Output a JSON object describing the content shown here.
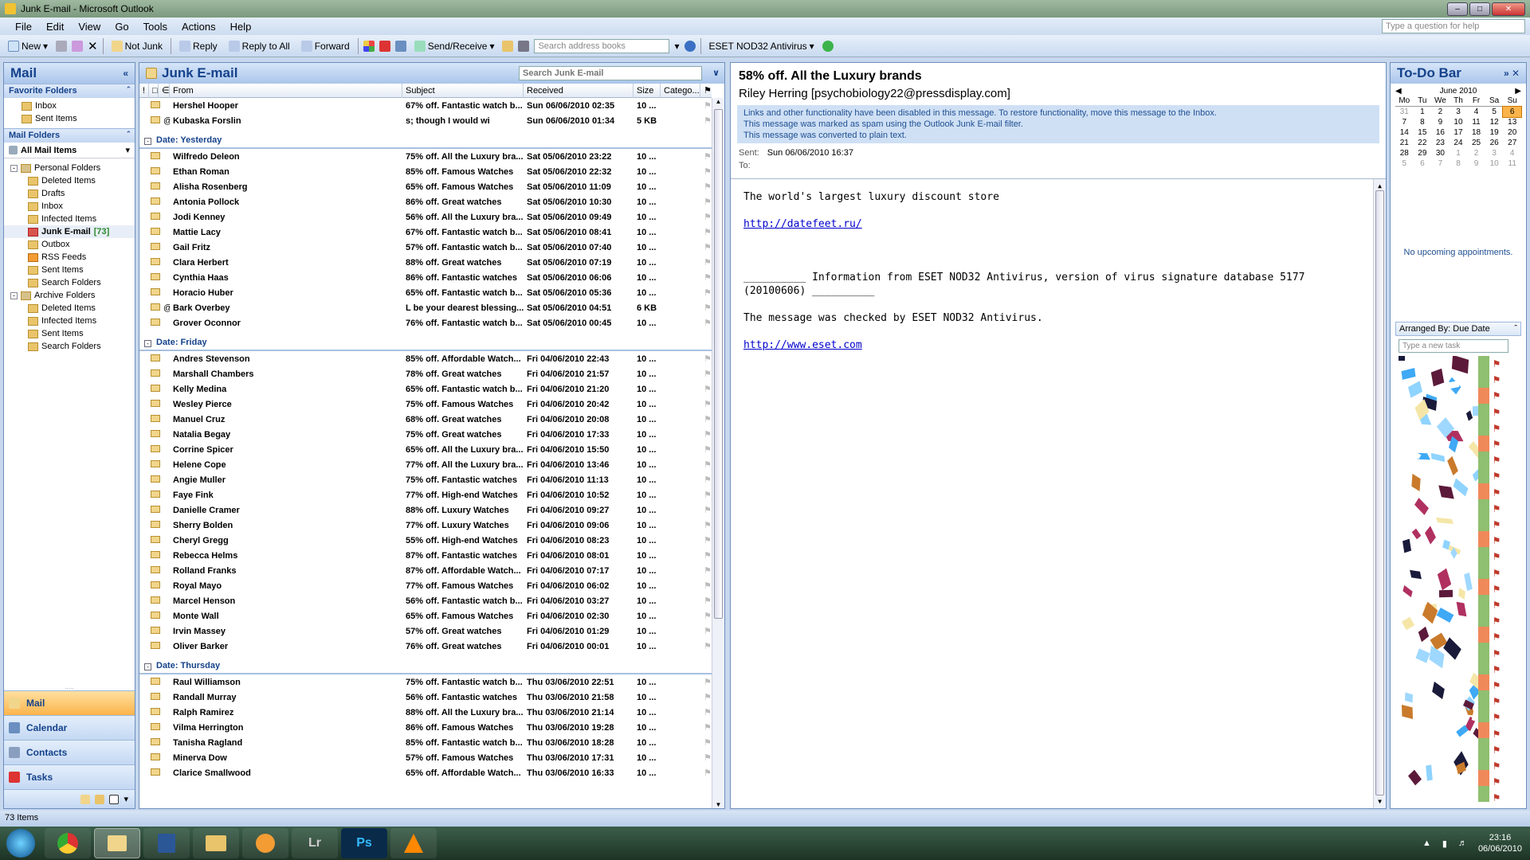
{
  "window": {
    "title": "Junk E-mail - Microsoft Outlook"
  },
  "menu": [
    "File",
    "Edit",
    "View",
    "Go",
    "Tools",
    "Actions",
    "Help"
  ],
  "help_placeholder": "Type a question for help",
  "toolbar": {
    "new": "New",
    "not_junk": "Not Junk",
    "reply": "Reply",
    "reply_all": "Reply to All",
    "forward": "Forward",
    "send_receive": "Send/Receive",
    "address_placeholder": "Search address books",
    "eset": "ESET NOD32 Antivirus"
  },
  "nav": {
    "title": "Mail",
    "favorites_title": "Favorite Folders",
    "favorites": [
      "Inbox",
      "Sent Items"
    ],
    "mail_folders_title": "Mail Folders",
    "all_mail_items": "All Mail Items",
    "tree": [
      {
        "label": "Personal Folders",
        "level": 1,
        "icon": "arc"
      },
      {
        "label": "Deleted Items",
        "level": 2,
        "icon": "del"
      },
      {
        "label": "Drafts",
        "level": 2,
        "icon": "f"
      },
      {
        "label": "Inbox",
        "level": 2,
        "icon": "f"
      },
      {
        "label": "Infected Items",
        "level": 2,
        "icon": "f"
      },
      {
        "label": "Junk E-mail",
        "level": 2,
        "icon": "red",
        "count": "[73]",
        "selected": true
      },
      {
        "label": "Outbox",
        "level": 2,
        "icon": "f"
      },
      {
        "label": "RSS Feeds",
        "level": 2,
        "icon": "rss"
      },
      {
        "label": "Sent Items",
        "level": 2,
        "icon": "f"
      },
      {
        "label": "Search Folders",
        "level": 2,
        "icon": "f"
      },
      {
        "label": "Archive Folders",
        "level": 1,
        "icon": "arc"
      },
      {
        "label": "Deleted Items",
        "level": 2,
        "icon": "del"
      },
      {
        "label": "Infected Items",
        "level": 2,
        "icon": "f"
      },
      {
        "label": "Sent Items",
        "level": 2,
        "icon": "f"
      },
      {
        "label": "Search Folders",
        "level": 2,
        "icon": "f"
      }
    ],
    "buttons": [
      "Mail",
      "Calendar",
      "Contacts",
      "Tasks"
    ]
  },
  "list": {
    "title": "Junk E-mail",
    "search_placeholder": "Search Junk E-mail",
    "columns": {
      "from": "From",
      "subject": "Subject",
      "received": "Received",
      "size": "Size",
      "category": "Catego..."
    },
    "top_rows": [
      {
        "from": "Hershel Hooper",
        "subject": "67% off. Fantastic watch b...",
        "received": "Sun 06/06/2010 02:35",
        "size": "10 ..."
      },
      {
        "from": "Kubaska Forslin",
        "subject": "s; though I would wi",
        "received": "Sun 06/06/2010 01:34",
        "size": "5 KB",
        "attach": true
      }
    ],
    "groups": [
      {
        "label": "Date: Yesterday",
        "rows": [
          {
            "from": "Wilfredo Deleon",
            "subject": "75% off. All the Luxury bra...",
            "received": "Sat 05/06/2010 23:22",
            "size": "10 ..."
          },
          {
            "from": "Ethan Roman",
            "subject": "85% off. Famous Watches",
            "received": "Sat 05/06/2010 22:32",
            "size": "10 ..."
          },
          {
            "from": "Alisha Rosenberg",
            "subject": "65% off. Famous Watches",
            "received": "Sat 05/06/2010 11:09",
            "size": "10 ..."
          },
          {
            "from": "Antonia Pollock",
            "subject": "86% off. Great watches",
            "received": "Sat 05/06/2010 10:30",
            "size": "10 ..."
          },
          {
            "from": "Jodi Kenney",
            "subject": "56% off. All the Luxury bra...",
            "received": "Sat 05/06/2010 09:49",
            "size": "10 ..."
          },
          {
            "from": "Mattie Lacy",
            "subject": "67% off. Fantastic watch b...",
            "received": "Sat 05/06/2010 08:41",
            "size": "10 ..."
          },
          {
            "from": "Gail Fritz",
            "subject": "57% off. Fantastic watch b...",
            "received": "Sat 05/06/2010 07:40",
            "size": "10 ..."
          },
          {
            "from": "Clara Herbert",
            "subject": "88% off. Great watches",
            "received": "Sat 05/06/2010 07:19",
            "size": "10 ..."
          },
          {
            "from": "Cynthia Haas",
            "subject": "86% off. Fantastic watches",
            "received": "Sat 05/06/2010 06:06",
            "size": "10 ..."
          },
          {
            "from": "Horacio Huber",
            "subject": "65% off. Fantastic watch b...",
            "received": "Sat 05/06/2010 05:36",
            "size": "10 ..."
          },
          {
            "from": "Bark Overbey",
            "subject": "L be your dearest blessing....",
            "received": "Sat 05/06/2010 04:51",
            "size": "6 KB",
            "attach": true
          },
          {
            "from": "Grover Oconnor",
            "subject": "76% off. Fantastic watch b...",
            "received": "Sat 05/06/2010 00:45",
            "size": "10 ..."
          }
        ]
      },
      {
        "label": "Date: Friday",
        "rows": [
          {
            "from": "Andres Stevenson",
            "subject": "85% off. Affordable Watch...",
            "received": "Fri 04/06/2010 22:43",
            "size": "10 ..."
          },
          {
            "from": "Marshall Chambers",
            "subject": "78% off. Great watches",
            "received": "Fri 04/06/2010 21:57",
            "size": "10 ..."
          },
          {
            "from": "Kelly Medina",
            "subject": "65% off. Fantastic watch b...",
            "received": "Fri 04/06/2010 21:20",
            "size": "10 ..."
          },
          {
            "from": "Wesley Pierce",
            "subject": "75% off. Famous Watches",
            "received": "Fri 04/06/2010 20:42",
            "size": "10 ..."
          },
          {
            "from": "Manuel Cruz",
            "subject": "68% off. Great watches",
            "received": "Fri 04/06/2010 20:08",
            "size": "10 ..."
          },
          {
            "from": "Natalia Begay",
            "subject": "75% off. Great watches",
            "received": "Fri 04/06/2010 17:33",
            "size": "10 ..."
          },
          {
            "from": "Corrine Spicer",
            "subject": "65% off. All the Luxury bra...",
            "received": "Fri 04/06/2010 15:50",
            "size": "10 ..."
          },
          {
            "from": "Helene Cope",
            "subject": "77% off. All the Luxury bra...",
            "received": "Fri 04/06/2010 13:46",
            "size": "10 ..."
          },
          {
            "from": "Angie Muller",
            "subject": "75% off. Fantastic watches",
            "received": "Fri 04/06/2010 11:13",
            "size": "10 ..."
          },
          {
            "from": "Faye Fink",
            "subject": "77% off. High-end Watches",
            "received": "Fri 04/06/2010 10:52",
            "size": "10 ..."
          },
          {
            "from": "Danielle Cramer",
            "subject": "88% off. Luxury Watches",
            "received": "Fri 04/06/2010 09:27",
            "size": "10 ..."
          },
          {
            "from": "Sherry Bolden",
            "subject": "77% off. Luxury Watches",
            "received": "Fri 04/06/2010 09:06",
            "size": "10 ..."
          },
          {
            "from": "Cheryl Gregg",
            "subject": "55% off. High-end Watches",
            "received": "Fri 04/06/2010 08:23",
            "size": "10 ..."
          },
          {
            "from": "Rebecca Helms",
            "subject": "87% off. Fantastic watches",
            "received": "Fri 04/06/2010 08:01",
            "size": "10 ..."
          },
          {
            "from": "Rolland Franks",
            "subject": "87% off. Affordable Watch...",
            "received": "Fri 04/06/2010 07:17",
            "size": "10 ..."
          },
          {
            "from": "Royal Mayo",
            "subject": "77% off. Famous Watches",
            "received": "Fri 04/06/2010 06:02",
            "size": "10 ..."
          },
          {
            "from": "Marcel Henson",
            "subject": "56% off. Fantastic watch b...",
            "received": "Fri 04/06/2010 03:27",
            "size": "10 ..."
          },
          {
            "from": "Monte Wall",
            "subject": "65% off. Famous Watches",
            "received": "Fri 04/06/2010 02:30",
            "size": "10 ..."
          },
          {
            "from": "Irvin Massey",
            "subject": "57% off. Great watches",
            "received": "Fri 04/06/2010 01:29",
            "size": "10 ..."
          },
          {
            "from": "Oliver Barker",
            "subject": "76% off. Great watches",
            "received": "Fri 04/06/2010 00:01",
            "size": "10 ..."
          }
        ]
      },
      {
        "label": "Date: Thursday",
        "rows": [
          {
            "from": "Raul Williamson",
            "subject": "75% off. Fantastic watch b...",
            "received": "Thu 03/06/2010 22:51",
            "size": "10 ..."
          },
          {
            "from": "Randall Murray",
            "subject": "56% off. Fantastic watches",
            "received": "Thu 03/06/2010 21:58",
            "size": "10 ..."
          },
          {
            "from": "Ralph Ramirez",
            "subject": "88% off. All the Luxury bra...",
            "received": "Thu 03/06/2010 21:14",
            "size": "10 ..."
          },
          {
            "from": "Vilma Herrington",
            "subject": "86% off. Famous Watches",
            "received": "Thu 03/06/2010 19:28",
            "size": "10 ..."
          },
          {
            "from": "Tanisha Ragland",
            "subject": "85% off. Fantastic watch b...",
            "received": "Thu 03/06/2010 18:28",
            "size": "10 ..."
          },
          {
            "from": "Minerva Dow",
            "subject": "57% off. Famous Watches",
            "received": "Thu 03/06/2010 17:31",
            "size": "10 ..."
          },
          {
            "from": "Clarice Smallwood",
            "subject": "65% off. Affordable Watch...",
            "received": "Thu 03/06/2010 16:33",
            "size": "10 ..."
          }
        ]
      }
    ]
  },
  "reading": {
    "subject": "58% off. All the Luxury brands",
    "sender": "Riley Herring [psychobiology22@pressdisplay.com]",
    "info": [
      "Links and other functionality have been disabled in this message. To restore functionality, move this message to the Inbox.",
      "This message was marked as spam using the Outlook Junk E-mail filter.",
      "This message was converted to plain text."
    ],
    "sent_label": "Sent:",
    "sent_value": "Sun 06/06/2010 16:37",
    "to_label": "To:",
    "body_line1": "The world's largest luxury discount store",
    "link1": "http://datefeet.ru/",
    "eset_line": "__________ Information from ESET NOD32 Antivirus, version of virus signature database 5177 (20100606) __________",
    "checked_line": "The message was checked by ESET NOD32 Antivirus.",
    "link2": "http://www.eset.com"
  },
  "todo": {
    "title": "To-Do Bar",
    "month": "June 2010",
    "days": [
      "Mo",
      "Tu",
      "We",
      "Th",
      "Fr",
      "Sa",
      "Su"
    ],
    "weeks": [
      [
        "31",
        "1",
        "2",
        "3",
        "4",
        "5",
        "6"
      ],
      [
        "7",
        "8",
        "9",
        "10",
        "11",
        "12",
        "13"
      ],
      [
        "14",
        "15",
        "16",
        "17",
        "18",
        "19",
        "20"
      ],
      [
        "21",
        "22",
        "23",
        "24",
        "25",
        "26",
        "27"
      ],
      [
        "28",
        "29",
        "30",
        "1",
        "2",
        "3",
        "4"
      ],
      [
        "5",
        "6",
        "7",
        "8",
        "9",
        "10",
        "11"
      ]
    ],
    "no_appointments": "No upcoming appointments.",
    "arranged_by": "Arranged By: Due Date",
    "new_task_placeholder": "Type a new task"
  },
  "status": {
    "items": "73 Items"
  },
  "taskbar": {
    "apps": [
      "",
      "",
      "",
      "",
      "",
      "Lr",
      "Ps",
      ""
    ],
    "time": "23:16",
    "date": "06/06/2010"
  },
  "colors": {
    "accent": "#15428b",
    "selected": "#fbb44b",
    "flag": "#c0392b"
  }
}
